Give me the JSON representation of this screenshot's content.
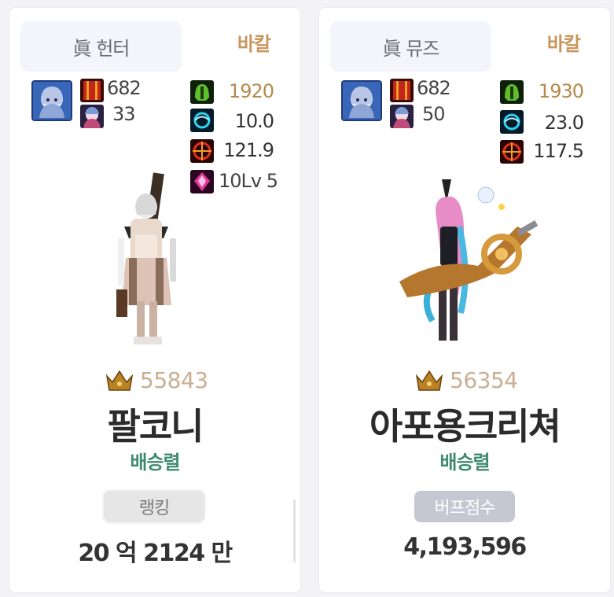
{
  "cards": [
    {
      "job": "眞 헌터",
      "server": "바칼",
      "avatar_icon": "hunter-portrait-icon",
      "stat_left": [
        {
          "icon": "red-book-icon",
          "value": "682"
        },
        {
          "icon": "creature-portrait-icon",
          "value": "33"
        }
      ],
      "stat_right": [
        {
          "icon": "green-helmet-icon",
          "value": "1920"
        },
        {
          "icon": "cyan-swirl-icon",
          "value": "10.0"
        },
        {
          "icon": "crosshair-icon",
          "value": "121.9"
        },
        {
          "icon": "pink-crystal-icon",
          "value": "10Lv 5"
        }
      ],
      "fame": "55843",
      "name": "팔코니",
      "guild": "배승렬",
      "badge": "랭킹",
      "score": "20 억 2124 만"
    },
    {
      "job": "眞 뮤즈",
      "server": "바칼",
      "avatar_icon": "muse-portrait-icon",
      "stat_left": [
        {
          "icon": "red-book-icon",
          "value": "682"
        },
        {
          "icon": "creature-portrait-icon",
          "value": "50"
        }
      ],
      "stat_right": [
        {
          "icon": "green-helmet-icon",
          "value": "1930"
        },
        {
          "icon": "cyan-swirl-icon",
          "value": "23.0"
        },
        {
          "icon": "crosshair-icon",
          "value": "117.5"
        }
      ],
      "fame": "56354",
      "name": "아포용크리쳐",
      "guild": "배승렬",
      "badge": "버프점수",
      "score": "4,193,596"
    }
  ],
  "colors": {
    "server": "#c9955a",
    "fame": "#c9ae92",
    "guild": "#3f8a6e",
    "gold_stat": "#b58a4a"
  }
}
